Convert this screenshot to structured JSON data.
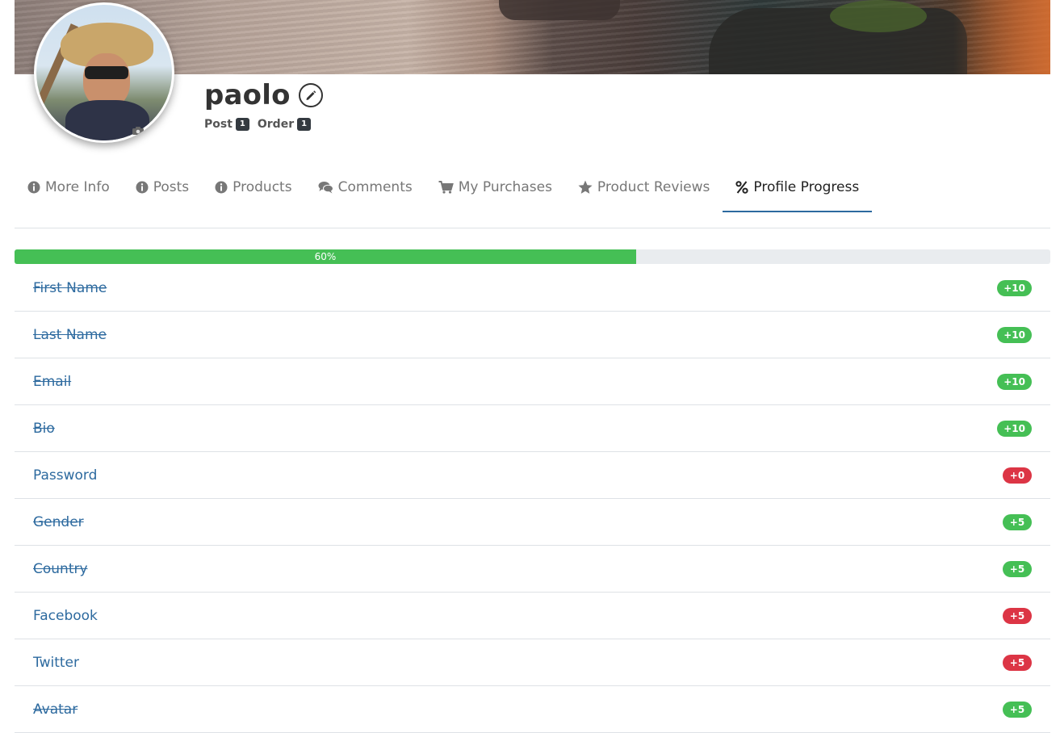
{
  "profile": {
    "username": "paolo",
    "stats": [
      {
        "label": "Post",
        "count": "1"
      },
      {
        "label": "Order",
        "count": "1"
      }
    ]
  },
  "tabs": [
    {
      "label": "More Info",
      "icon": "info-circle-icon"
    },
    {
      "label": "Posts",
      "icon": "info-circle-icon"
    },
    {
      "label": "Products",
      "icon": "info-circle-icon"
    },
    {
      "label": "Comments",
      "icon": "comments-icon"
    },
    {
      "label": "My Purchases",
      "icon": "cart-icon"
    },
    {
      "label": "Product Reviews",
      "icon": "star-icon"
    },
    {
      "label": "Profile Progress",
      "icon": "percent-icon",
      "active": true
    }
  ],
  "progress": {
    "value": 60,
    "label": "60%"
  },
  "checklist": [
    {
      "label": "First Name",
      "points": "+10",
      "done": true
    },
    {
      "label": "Last Name",
      "points": "+10",
      "done": true
    },
    {
      "label": "Email",
      "points": "+10",
      "done": true
    },
    {
      "label": "Bio",
      "points": "+10",
      "done": true
    },
    {
      "label": "Password",
      "points": "+0",
      "done": false
    },
    {
      "label": "Gender",
      "points": "+5",
      "done": true
    },
    {
      "label": "Country",
      "points": "+5",
      "done": true
    },
    {
      "label": "Facebook",
      "points": "+5",
      "done": false
    },
    {
      "label": "Twitter",
      "points": "+5",
      "done": false
    },
    {
      "label": "Avatar",
      "points": "+5",
      "done": true
    }
  ],
  "colors": {
    "accent": "#2d6a9f",
    "success": "#45bf55",
    "danger": "#dc3545"
  }
}
